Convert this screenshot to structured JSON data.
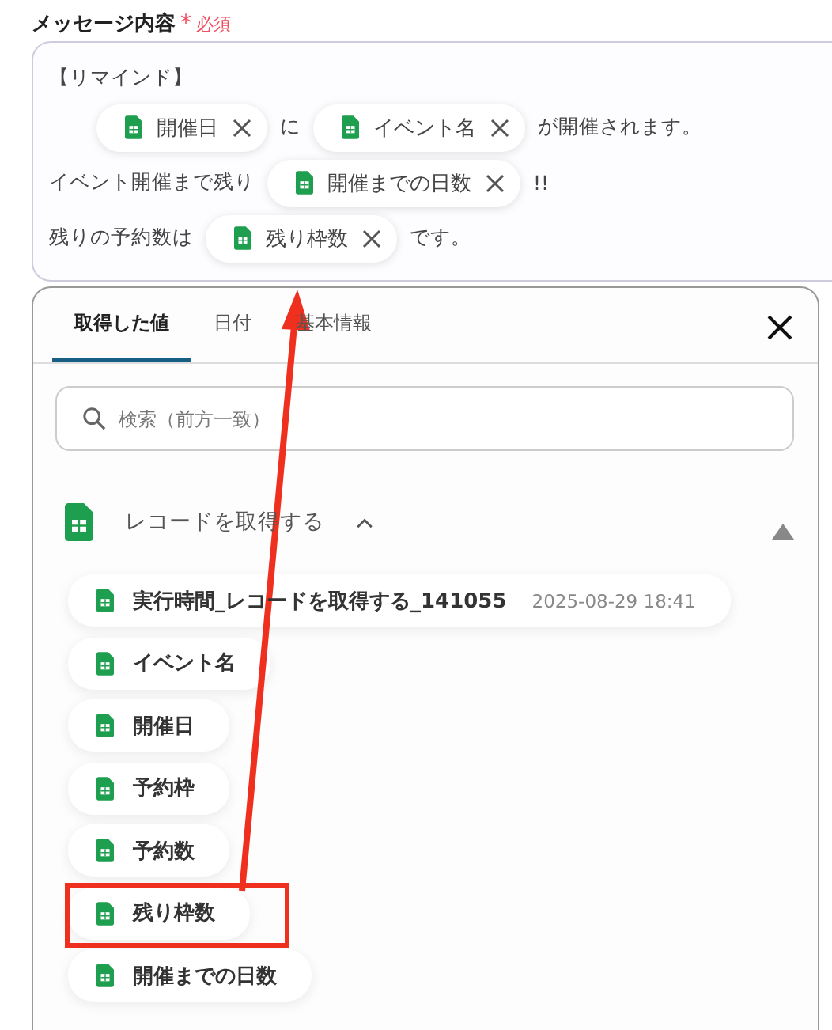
{
  "field": {
    "label": "メッセージ内容",
    "required_mark": "*",
    "required_text": "必須"
  },
  "message": {
    "lines": [
      {
        "segments": [
          {
            "kind": "text",
            "text": "【リマインド】"
          }
        ]
      },
      {
        "segments": [
          {
            "kind": "chip",
            "text": "開催日"
          },
          {
            "kind": "text",
            "text": "に"
          },
          {
            "kind": "chip",
            "text": "イベント名"
          },
          {
            "kind": "text",
            "text": "が開催されます。"
          }
        ]
      },
      {
        "segments": [
          {
            "kind": "text",
            "text": "イベント開催まで残り"
          },
          {
            "kind": "chip",
            "text": "開催までの日数"
          },
          {
            "kind": "text",
            "text": "!!"
          }
        ]
      },
      {
        "segments": [
          {
            "kind": "text",
            "text": "残りの予約数は"
          },
          {
            "kind": "chip",
            "text": "残り枠数"
          },
          {
            "kind": "text",
            "text": "です。"
          }
        ]
      }
    ]
  },
  "panel": {
    "tabs": [
      {
        "label": "取得した値",
        "selected": true
      },
      {
        "label": "日付",
        "selected": false
      },
      {
        "label": "基本情報",
        "selected": false
      }
    ],
    "search": {
      "placeholder": "検索（前方一致）"
    },
    "section": {
      "title": "レコードを取得する",
      "expanded": true,
      "items": [
        {
          "label": "実行時間_レコードを取得する_141055",
          "value": "2025-08-29 18:41",
          "highlighted": false
        },
        {
          "label": "イベント名",
          "highlighted": false
        },
        {
          "label": "開催日",
          "highlighted": false
        },
        {
          "label": "予約枠",
          "highlighted": false
        },
        {
          "label": "予約数",
          "highlighted": false
        },
        {
          "label": "残り枠数",
          "highlighted": true
        },
        {
          "label": "開催までの日数",
          "highlighted": false
        }
      ]
    }
  }
}
